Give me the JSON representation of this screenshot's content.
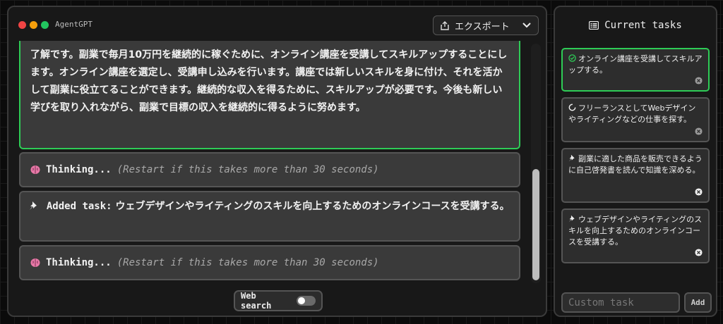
{
  "app": {
    "title": "AgentGPT",
    "window_dots": [
      "#ef4444",
      "#f59e0b",
      "#22c55e"
    ]
  },
  "header": {
    "export_label": "エクスポート",
    "export_icon": "share-icon",
    "chevron_icon": "chevron-down-icon"
  },
  "messages": {
    "main_text": "了解です。副業で毎月10万円を継続的に稼ぐために、オンライン講座を受講してスキルアップすることにします。オンライン講座を選定し、受講申し込みを行います。講座では新しいスキルを身に付け、それを活かして副業に役立てることができます。継続的な収入を得るために、スキルアップが必要です。今後も新しい学びを取り入れながら、副業で目標の収入を継続的に得るように努めます。",
    "thinking_label": "Thinking...",
    "thinking_hint": "(Restart if this takes more than 30 seconds)",
    "added_task_label": "Added task:",
    "added_task_text": "ウェブデザインやライティングのスキルを向上するためのオンラインコースを受講する。"
  },
  "footer": {
    "web_search_label": "Web search",
    "web_search_on": false
  },
  "sidebar": {
    "title": "Current tasks",
    "tasks": [
      {
        "text": "オンライン講座を受講してスキルアップする。",
        "status": "completed"
      },
      {
        "text": "フリーランスとしてWebデザインやライティングなどの仕事を探す。",
        "status": "in-progress"
      },
      {
        "text": "副業に適した商品を販売できるように自己啓発書を読んで知識を深める。",
        "status": "pending"
      },
      {
        "text": "ウェブデザインやライティングのスキルを向上するためのオンラインコースを受講する。",
        "status": "pending"
      }
    ],
    "custom_task_placeholder": "Custom task",
    "add_label": "Add"
  },
  "colors": {
    "accent_green": "#2ecc56",
    "brain_pink": "#e879a8"
  }
}
